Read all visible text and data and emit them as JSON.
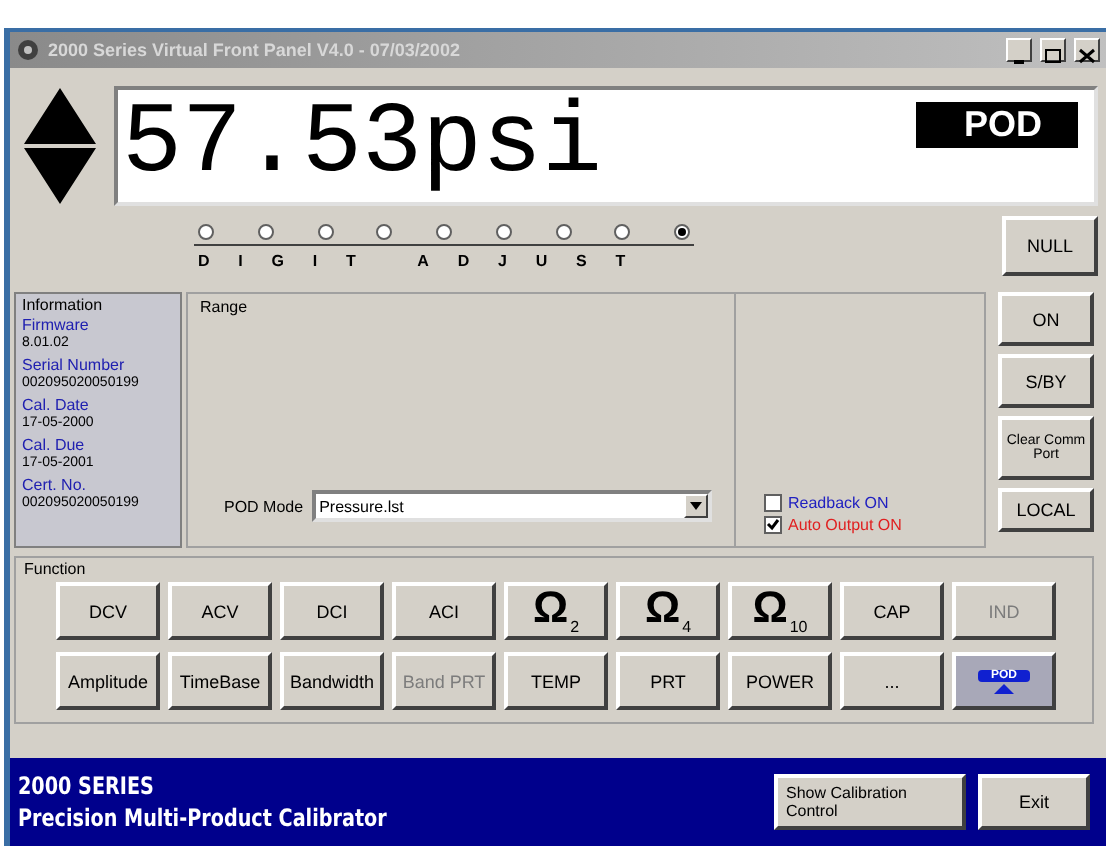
{
  "window": {
    "title": "2000 Series Virtual Front Panel V4.0 - 07/03/2002"
  },
  "display": {
    "reading": "57.53psi",
    "mode_badge": "POD"
  },
  "digit_adjust": {
    "label": "DIGIT ADJUST",
    "positions": [
      {
        "selected": false
      },
      {
        "selected": false
      },
      {
        "selected": false
      },
      {
        "selected": false
      },
      {
        "selected": false
      },
      {
        "selected": false
      },
      {
        "selected": false
      },
      {
        "selected": false
      },
      {
        "selected": true
      }
    ]
  },
  "null_button": "NULL",
  "information": {
    "title": "Information",
    "items": [
      {
        "label": "Firmware",
        "value": "8.01.02"
      },
      {
        "label": "Serial Number",
        "value": "002095020050199"
      },
      {
        "label": "Cal. Date",
        "value": "17-05-2000"
      },
      {
        "label": "Cal. Due",
        "value": "17-05-2001"
      },
      {
        "label": "Cert. No.",
        "value": "002095020050199"
      }
    ]
  },
  "range": {
    "title": "Range",
    "pod_mode_label": "POD Mode",
    "pod_mode_value": "Pressure.lst"
  },
  "options": [
    {
      "label": "Readback ON",
      "checked": false,
      "color": "#2020c0"
    },
    {
      "label": "Auto Output ON",
      "checked": true,
      "color": "#e02020"
    }
  ],
  "side_buttons": [
    {
      "label": "ON"
    },
    {
      "label": "S/BY"
    },
    {
      "label": "Clear Comm Port"
    },
    {
      "label": "LOCAL"
    }
  ],
  "function": {
    "title": "Function",
    "rows": [
      [
        {
          "kind": "text",
          "label": "DCV",
          "disabled": false
        },
        {
          "kind": "text",
          "label": "ACV",
          "disabled": false
        },
        {
          "kind": "text",
          "label": "DCI",
          "disabled": false
        },
        {
          "kind": "text",
          "label": "ACI",
          "disabled": false
        },
        {
          "kind": "ohm",
          "label": "Ω",
          "sub": "2",
          "disabled": false
        },
        {
          "kind": "ohm",
          "label": "Ω",
          "sub": "4",
          "disabled": false
        },
        {
          "kind": "ohm",
          "label": "Ω",
          "sub": "10",
          "disabled": false
        },
        {
          "kind": "text",
          "label": "CAP",
          "disabled": false
        },
        {
          "kind": "text",
          "label": "IND",
          "disabled": true
        }
      ],
      [
        {
          "kind": "text",
          "label": "Amplitude",
          "disabled": false
        },
        {
          "kind": "text",
          "label": "TimeBase",
          "disabled": false
        },
        {
          "kind": "text",
          "label": "Bandwidth",
          "disabled": false
        },
        {
          "kind": "text",
          "label": "Band PRT",
          "disabled": true
        },
        {
          "kind": "text",
          "label": "TEMP",
          "disabled": false
        },
        {
          "kind": "text",
          "label": "PRT",
          "disabled": false
        },
        {
          "kind": "text",
          "label": "POWER",
          "disabled": false
        },
        {
          "kind": "text",
          "label": "...",
          "disabled": false
        },
        {
          "kind": "pod",
          "label": "POD",
          "disabled": false,
          "selected": true
        }
      ]
    ]
  },
  "banner": {
    "line1": "2000 SERIES",
    "line2": "Precision Multi-Product Calibrator"
  },
  "footer_buttons": [
    {
      "label": "Show Calibration Control"
    },
    {
      "label": "Exit"
    }
  ]
}
